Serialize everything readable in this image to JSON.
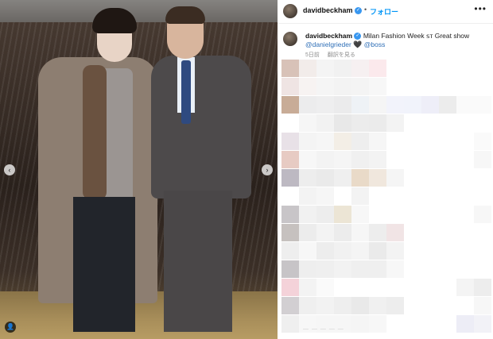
{
  "header": {
    "username": "davidbeckham",
    "separator": "•",
    "follow_label": "フォロー",
    "more_label": "•••"
  },
  "caption": {
    "username": "davidbeckham",
    "text": "Milan Fashion Week ꜱᴛ Great show",
    "mention1": "@danielgrieder",
    "heart": "🖤",
    "mention2": "@boss",
    "time_ago": "5日前",
    "translate_label": "翻訳を見る"
  },
  "photo": {
    "prev_icon": "‹",
    "next_icon": "›",
    "tag_icon": "👤"
  },
  "mosaic": {
    "rows": [
      [
        "#d8c2b8",
        "#f2ecea",
        "#f4f4f4",
        "#f1f1f1",
        "#f6f0f1",
        "#fbe9ec",
        "#ffffff",
        "#ffffff",
        "#ffffff",
        "#ffffff",
        "#ffffff",
        "#ffffff"
      ],
      [
        "#efe4e3",
        "#f7f3f2",
        "#f5f5f5",
        "#f3f3f3",
        "#f4f4f4",
        "#f7f7f7",
        "#ffffff",
        "#ffffff",
        "#ffffff",
        "#ffffff",
        "#ffffff",
        "#ffffff"
      ],
      [
        "#c8ac97",
        "#ececed",
        "#eeeeef",
        "#ebebec",
        "#eef2f6",
        "#f5f5f5",
        "#f2f3fb",
        "#f1f3fb",
        "#eeeef8",
        "#ececec",
        "#fafafa",
        "#fafafa"
      ],
      [
        "#ffffff",
        "#f6f6f6",
        "#f2f2f2",
        "#e8e8e8",
        "#ececec",
        "#ebebeb",
        "#f3f3f3",
        "#ffffff",
        "#ffffff",
        "#ffffff",
        "#ffffff",
        "#ffffff"
      ],
      [
        "#e8e1e7",
        "#f4f4f4",
        "#f6f6f6",
        "#f3eee6",
        "#eeeeee",
        "#f6f6f6",
        "#ffffff",
        "#ffffff",
        "#ffffff",
        "#ffffff",
        "#ffffff",
        "#fafafa"
      ],
      [
        "#e7cbc3",
        "#f7f7f7",
        "#f3f3f3",
        "#f5f5f5",
        "#f0f0f0",
        "#f3f3f3",
        "#ffffff",
        "#ffffff",
        "#ffffff",
        "#ffffff",
        "#ffffff",
        "#f7f7f7"
      ],
      [
        "#bdb9c2",
        "#ededed",
        "#eaeaea",
        "#efefef",
        "#e9dac8",
        "#f0e7dd",
        "#f5f5f5",
        "#ffffff",
        "#ffffff",
        "#ffffff",
        "#ffffff",
        "#ffffff"
      ],
      [
        "#ffffff",
        "#f3f3f3",
        "#f6f6f6",
        "#ffffff",
        "#f3f3f3",
        "#ffffff",
        "#ffffff",
        "#ffffff",
        "#ffffff",
        "#ffffff",
        "#ffffff",
        "#ffffff"
      ],
      [
        "#c8c5c8",
        "#f1f1f1",
        "#ededed",
        "#ece5d5",
        "#f7f7f7",
        "#ffffff",
        "#ffffff",
        "#ffffff",
        "#ffffff",
        "#ffffff",
        "#ffffff",
        "#f7f7f7"
      ],
      [
        "#c6c1bf",
        "#ececec",
        "#f3f3f3",
        "#ececec",
        "#f6f6f6",
        "#ededed",
        "#f1e4e5",
        "#ffffff",
        "#ffffff",
        "#ffffff",
        "#ffffff",
        "#ffffff"
      ],
      [
        "#eeeeee",
        "#f7f7f7",
        "#ededed",
        "#f1f1f1",
        "#f4f4f4",
        "#eaeaea",
        "#f3f3f3",
        "#ffffff",
        "#ffffff",
        "#ffffff",
        "#ffffff",
        "#ffffff"
      ],
      [
        "#c7c4c7",
        "#eeeeee",
        "#efefef",
        "#f2f2f2",
        "#efefef",
        "#efefef",
        "#f7f7f7",
        "#ffffff",
        "#ffffff",
        "#ffffff",
        "#ffffff",
        "#ffffff"
      ],
      [
        "#f4d2d9",
        "#f3f3f3",
        "#fafafa",
        "#ffffff",
        "#ffffff",
        "#ffffff",
        "#ffffff",
        "#ffffff",
        "#ffffff",
        "#ffffff",
        "#f4f4f4",
        "#ededed"
      ],
      [
        "#d2cfd2",
        "#efefef",
        "#f2f2f2",
        "#eeeeee",
        "#e9e9e9",
        "#f0f0f0",
        "#ededed",
        "#ffffff",
        "#ffffff",
        "#ffffff",
        "#ffffff",
        "#f7f7f7"
      ],
      [
        "#efefef",
        "#f7f7f7",
        "#f6f6f6",
        "#f6f6f6",
        "#f5f5f5",
        "#f7f7f7",
        "#ffffff",
        "#ffffff",
        "#ffffff",
        "#ffffff",
        "#ededf6",
        "#f2f2f7"
      ]
    ]
  }
}
